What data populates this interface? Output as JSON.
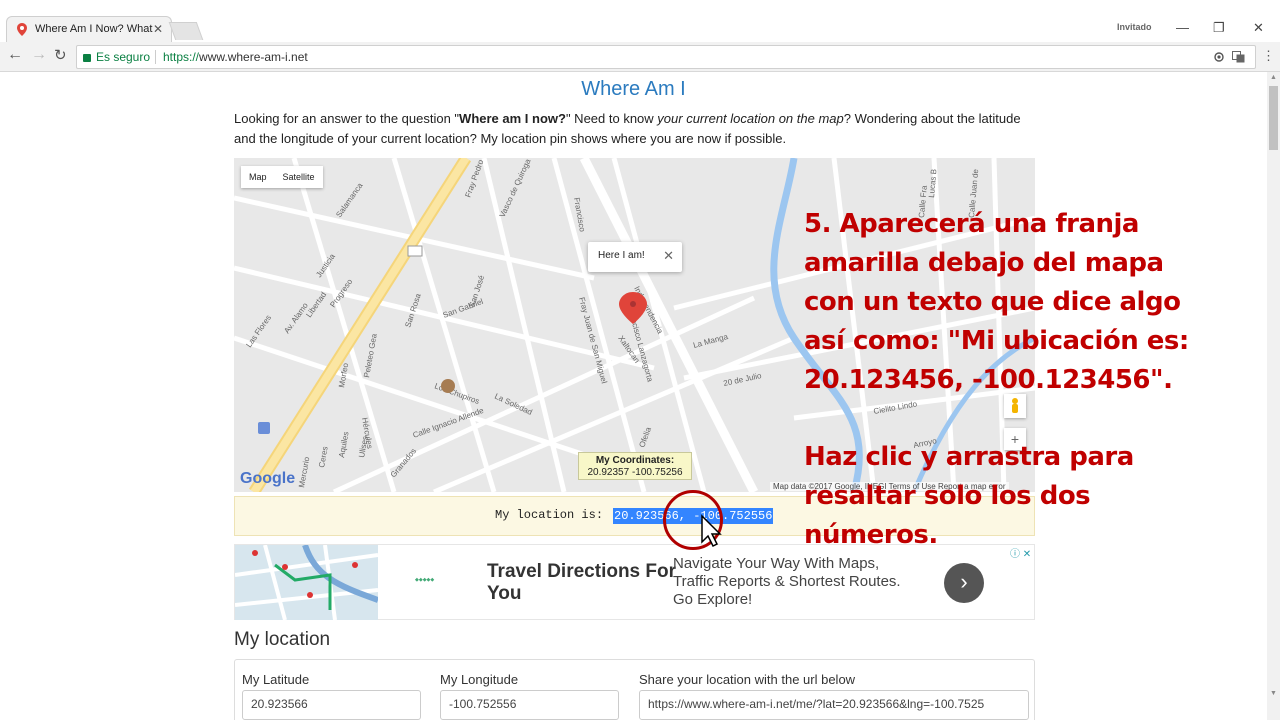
{
  "browser": {
    "tab_title": "Where Am I Now? What",
    "guest_label": "Invitado",
    "secure_label": "Es seguro",
    "url_scheme": "https://",
    "url_rest": "www.where-am-i.net"
  },
  "page": {
    "title": "Where Am I",
    "intro_1": "Looking for an answer to the question \"",
    "intro_bold": "Where am I now?",
    "intro_2": "\" Need to know ",
    "intro_italic": "your current location on the map",
    "intro_3": "? Wondering about the latitude and the longitude of your current location? My location pin shows where you are now if possible."
  },
  "map": {
    "type_map": "Map",
    "type_satellite": "Satellite",
    "bubble": "Here I am!",
    "coords_title": "My Coordinates:",
    "coords_value": "20.92357 -100.75256",
    "footer": "Map data ©2017 Google, INEGI   Terms of Use   Report a map error",
    "streets": [
      "Fray Pedro de Gante",
      "Vasco de Quiroga",
      "Francisco",
      "Independencia",
      "Salamanca",
      "Justicia",
      "Progreso",
      "Libertad",
      "Av. Alamo",
      "Las Flores",
      "Morfeo",
      "Peleteo Gea",
      "San Rosa",
      "San José",
      "San Gabriel",
      "Fray Juan de San Miguel",
      "Xaltocan",
      "Francisco Lanzagorta",
      "La Manga",
      "20 de Julio",
      "Cielito Lindo",
      "Arroyo",
      "Mercurio",
      "Ceres",
      "Aquiles",
      "Ulises",
      "Granados",
      "Hércules",
      "Los Chupiros",
      "La Soledad",
      "Calle Ignacio Allende",
      "Ofelia",
      "Lucas B",
      "Calle Fra",
      "Calle Juan de"
    ]
  },
  "location": {
    "label": "My location is:",
    "value": "20.923566, -100.752556"
  },
  "ad": {
    "title": "Travel Directions For You",
    "text": "Navigate Your Way With Maps, Traffic Reports & Shortest Routes. Go Explore!",
    "go": "›",
    "info": "ⓘ ✕"
  },
  "section": {
    "heading": "My location",
    "lat_label": "My Latitude",
    "lat_value": "20.923566",
    "lng_label": "My Longitude",
    "lng_value": "-100.752556",
    "share_label": "Share your location with the url below",
    "share_value": "https://www.where-am-i.net/me/?lat=20.923566&lng=-100.7525"
  },
  "overlay": {
    "lines_1": [
      "5. Aparecerá una franja",
      "amarilla debajo del mapa",
      "con un texto que dice algo",
      "así como: \"Mi ubicación es:",
      "20.123456, -100.123456\"."
    ],
    "lines_2": [
      "Haz clic y arrastra para",
      "resaltar solo los dos",
      "números."
    ]
  },
  "colors": {
    "accent": "#2b7bbf",
    "overlay": "#c00000",
    "highlight": "#3385ff",
    "strip": "#fcf8e3"
  }
}
